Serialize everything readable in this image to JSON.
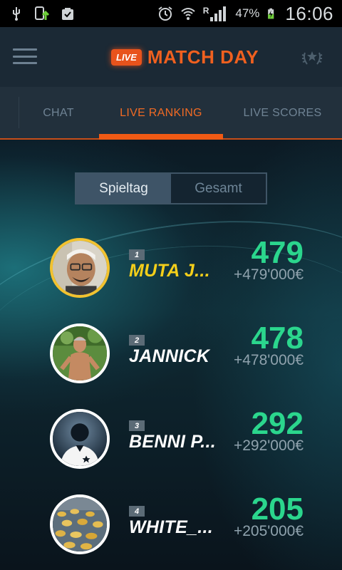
{
  "statusbar": {
    "battery": "47%",
    "roaming": "R",
    "time": "16:06"
  },
  "appbar": {
    "badge": "LIVE",
    "title": "MATCH DAY"
  },
  "tabs": [
    {
      "label": "CHAT",
      "active": false
    },
    {
      "label": "LIVE RANKING",
      "active": true
    },
    {
      "label": "LIVE SCORES",
      "active": false
    }
  ],
  "segment": {
    "options": [
      {
        "label": "Spieltag",
        "active": true
      },
      {
        "label": "Gesamt",
        "active": false
      }
    ]
  },
  "ranking": [
    {
      "rank": "1",
      "name": "MUTA J...",
      "points": "479",
      "money": "+479'000€",
      "highlight": true
    },
    {
      "rank": "2",
      "name": "JANNICK",
      "points": "478",
      "money": "+478'000€",
      "highlight": false
    },
    {
      "rank": "3",
      "name": "BENNI P...",
      "points": "292",
      "money": "+292'000€",
      "highlight": false
    },
    {
      "rank": "4",
      "name": "WHITE_...",
      "points": "205",
      "money": "+205'000€",
      "highlight": false
    }
  ],
  "colors": {
    "accent": "#f05a14",
    "points": "#2bd68d",
    "highlight": "#f4cf1a"
  }
}
